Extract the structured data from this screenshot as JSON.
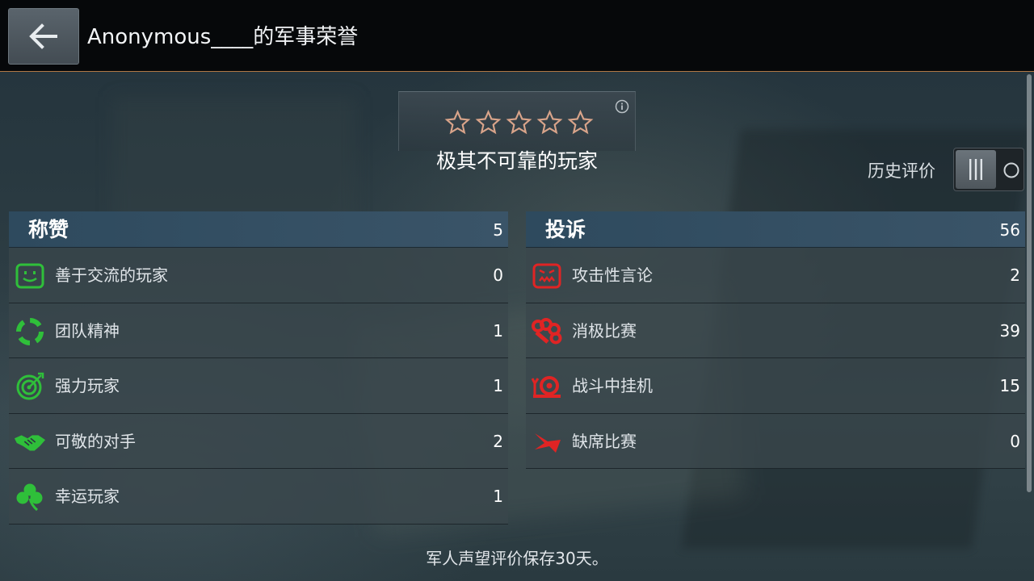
{
  "header": {
    "title": "Anonymous____的军事荣誉",
    "back_icon": "arrow-left-icon"
  },
  "rating": {
    "stars_filled": 0,
    "stars_total": 5,
    "text": "极其不可靠的玩家",
    "info_icon": "info-icon"
  },
  "history": {
    "label": "历史评价",
    "toggle_state": "on"
  },
  "praise": {
    "title": "称赞",
    "total": "5",
    "items": [
      {
        "label": "善于交流的玩家",
        "count": "0",
        "icon": "smiley-icon"
      },
      {
        "label": "团队精神",
        "count": "1",
        "icon": "team-ring-icon"
      },
      {
        "label": "强力玩家",
        "count": "1",
        "icon": "target-icon"
      },
      {
        "label": "可敬的对手",
        "count": "2",
        "icon": "handshake-icon"
      },
      {
        "label": "幸运玩家",
        "count": "1",
        "icon": "clover-icon"
      }
    ]
  },
  "complaints": {
    "title": "投诉",
    "total": "56",
    "items": [
      {
        "label": "攻击性言论",
        "count": "2",
        "icon": "angry-face-icon"
      },
      {
        "label": "消极比赛",
        "count": "39",
        "icon": "brass-knuckles-icon"
      },
      {
        "label": "战斗中挂机",
        "count": "15",
        "icon": "snail-icon"
      },
      {
        "label": "缺席比赛",
        "count": "0",
        "icon": "escape-arrow-icon"
      }
    ]
  },
  "footer": {
    "text": "军人声望评价保存30天。"
  },
  "colors": {
    "praise_icon": "#2fbf3a",
    "complaint_icon": "#e02424",
    "header_bg": "#06080a",
    "header_border": "#b07845",
    "panel_head": "#34506a"
  }
}
